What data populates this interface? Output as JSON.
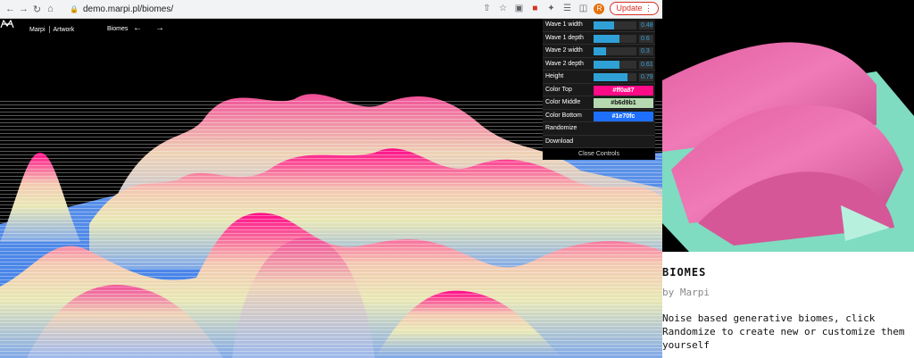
{
  "browser": {
    "url": "demo.marpi.pl/biomes/",
    "update_label": "Update",
    "avatar_letter": "R",
    "nav_icons": [
      "back-icon",
      "forward-icon",
      "reload-icon",
      "home-icon"
    ],
    "toolbar_icons": [
      "share-icon",
      "star-icon",
      "extension-icon",
      "puzzle-icon",
      "media-icon",
      "sidepanel-icon"
    ]
  },
  "site": {
    "brand": "Marpi",
    "section": "Artwork",
    "crumb": "Biomes"
  },
  "controls": {
    "sliders": [
      {
        "label": "Wave 1 width",
        "value": "0.48",
        "fraction": 0.48
      },
      {
        "label": "Wave 1 depth",
        "value": "0.6",
        "fraction": 0.6
      },
      {
        "label": "Wave 2 width",
        "value": "0.3",
        "fraction": 0.3
      },
      {
        "label": "Wave 2 depth",
        "value": "0.61",
        "fraction": 0.61
      },
      {
        "label": "Height",
        "value": "0.79",
        "fraction": 0.79
      }
    ],
    "colors": [
      {
        "label": "Color Top",
        "value": "#ff0a87",
        "text_color": "#ffffff"
      },
      {
        "label": "Color Middle",
        "value": "#b6d9b1",
        "text_color": "#111111"
      },
      {
        "label": "Color Bottom",
        "value": "#1e70fc",
        "text_color": "#ffffff"
      }
    ],
    "randomize_label": "Randomize",
    "download_label": "Download",
    "close_label": "Close Controls"
  },
  "card": {
    "title": "BIOMES",
    "author": "by Marpi",
    "description": "Noise based generative biomes, click Randomize to create new or customize them yourself"
  }
}
